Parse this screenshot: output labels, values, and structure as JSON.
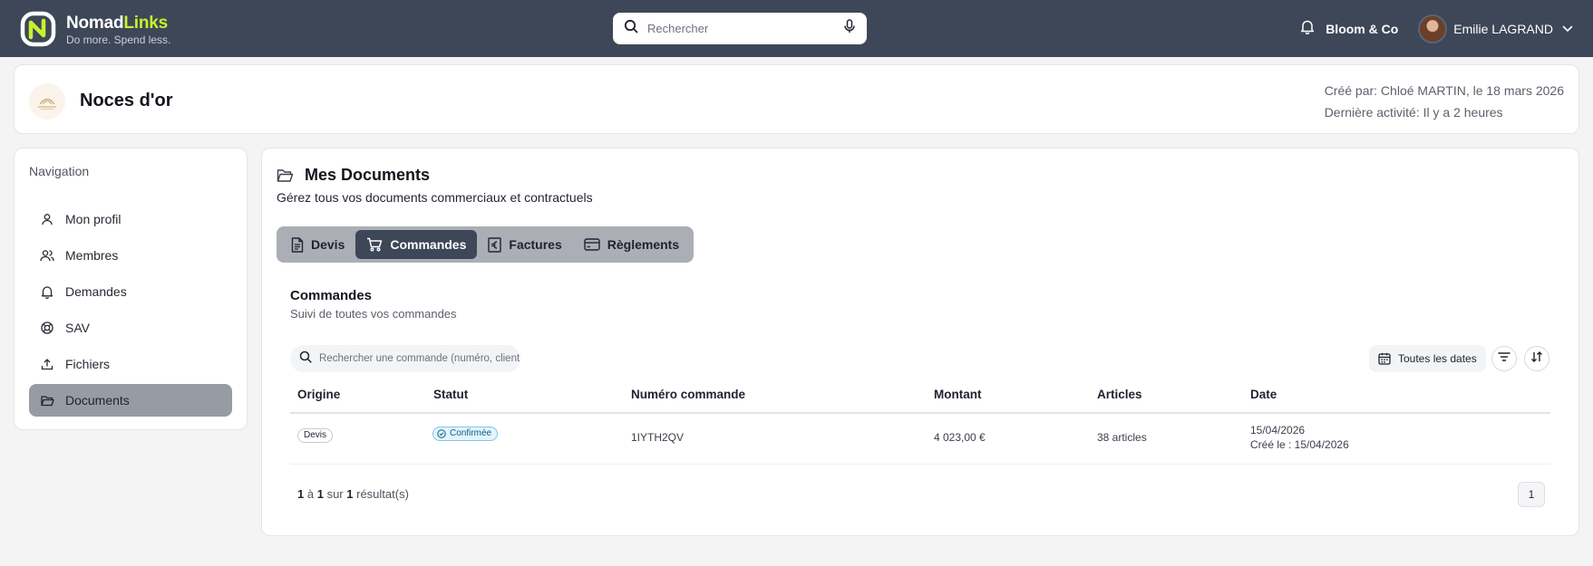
{
  "topbar": {
    "brand_name_primary": "Nomad",
    "brand_name_accent": "Links",
    "brand_tagline": "Do more. Spend less.",
    "search_placeholder": "Rechercher",
    "organization": "Bloom & Co",
    "user_name": "Emilie LAGRAND",
    "accent_color": "#c6f32e",
    "bar_color": "#3e4757"
  },
  "project": {
    "title": "Noces d'or",
    "created_by": "Créé par: Chloé MARTIN, le 18 mars 2026",
    "last_activity": "Dernière activité: Il y a 2 heures"
  },
  "sidebar": {
    "title": "Navigation",
    "items": [
      {
        "label": "Mon profil",
        "icon": "user-icon"
      },
      {
        "label": "Membres",
        "icon": "users-icon"
      },
      {
        "label": "Demandes",
        "icon": "bell-icon"
      },
      {
        "label": "SAV",
        "icon": "lifebuoy-icon"
      },
      {
        "label": "Fichiers",
        "icon": "upload-icon"
      },
      {
        "label": "Documents",
        "icon": "folder-icon",
        "active": true
      }
    ]
  },
  "main": {
    "title": "Mes Documents",
    "subtitle": "Gérez tous vos documents commerciaux et contractuels",
    "tabs": [
      {
        "label": "Devis",
        "icon": "file-text-icon"
      },
      {
        "label": "Commandes",
        "icon": "cart-icon",
        "active": true
      },
      {
        "label": "Factures",
        "icon": "euro-receipt-icon"
      },
      {
        "label": "Règlements",
        "icon": "credit-card-icon"
      }
    ],
    "section_title": "Commandes",
    "section_subtitle": "Suivi de toutes vos commandes",
    "order_search_placeholder": "Rechercher une commande (numéro, client...)",
    "date_filter_label": "Toutes les dates",
    "table": {
      "columns": [
        "Origine",
        "Statut",
        "Numéro commande",
        "Montant",
        "Articles",
        "Date"
      ],
      "rows": [
        {
          "origin": "Devis",
          "status": "Confirmée",
          "number": "1IYTH2QV",
          "amount": "4 023,00 €",
          "articles": "38 articles",
          "date": "15/04/2026",
          "created": "Créé le : 15/04/2026"
        }
      ]
    },
    "pagination": {
      "from": "1",
      "word_to": "à",
      "to": "1",
      "word_of": "sur",
      "total": "1",
      "suffix": "résultat(s)",
      "current_page": "1"
    }
  }
}
